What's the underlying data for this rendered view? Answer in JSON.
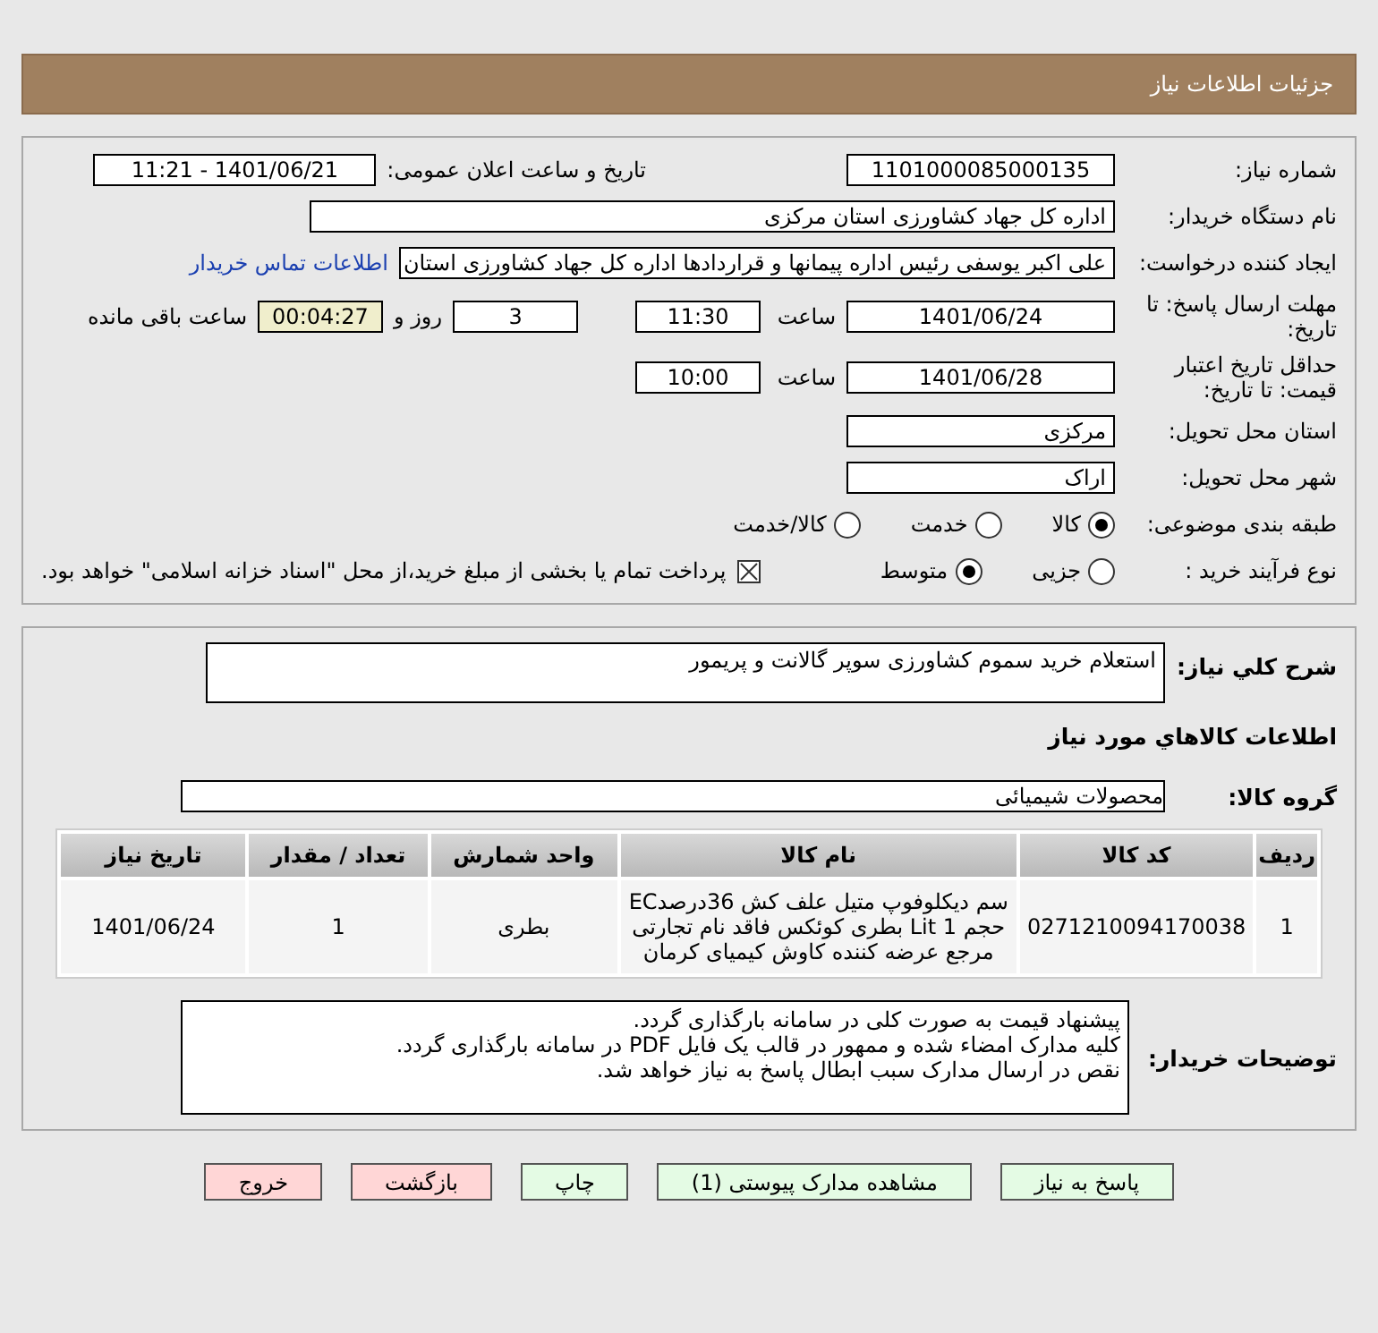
{
  "header": {
    "title": "جزئیات اطلاعات نیاز"
  },
  "details": {
    "need_number": {
      "label": "شماره نیاز:",
      "value": "1101000085000135"
    },
    "announce": {
      "label": "تاریخ و ساعت اعلان عمومی:",
      "value": "1401/06/21 - 11:21"
    },
    "buyer": {
      "label": "نام دستگاه خریدار:",
      "value": "اداره کل جهاد کشاورزی استان مرکزی"
    },
    "creator": {
      "label": "ایجاد کننده درخواست:",
      "value": "علی اکبر یوسفی رئیس اداره پیمانها و قراردادها اداره کل جهاد کشاورزی استان",
      "link": "اطلاعات تماس خریدار"
    },
    "deadline": {
      "label": "مهلت ارسال پاسخ: تا تاریخ:",
      "date": "1401/06/24",
      "time_label": "ساعت",
      "time": "11:30",
      "days": "3",
      "days_label": "روز و",
      "remaining": "00:04:27",
      "remaining_label": "ساعت باقی مانده"
    },
    "validity": {
      "label": "حداقل تاریخ اعتبار قیمت: تا تاریخ:",
      "date": "1401/06/28",
      "time_label": "ساعت",
      "time": "10:00"
    },
    "province": {
      "label": "استان محل تحویل:",
      "value": "مرکزی"
    },
    "city": {
      "label": "شهر محل تحویل:",
      "value": "اراک"
    },
    "category": {
      "label": "طبقه بندی موضوعی:",
      "options": [
        {
          "label": "کالا",
          "selected": true
        },
        {
          "label": "خدمت",
          "selected": false
        },
        {
          "label": "کالا/خدمت",
          "selected": false
        }
      ]
    },
    "process": {
      "label": "نوع فرآیند خرید :",
      "options": [
        {
          "label": "جزیی",
          "selected": false
        },
        {
          "label": "متوسط",
          "selected": true
        }
      ],
      "payment": {
        "checked": true,
        "text": "پرداخت تمام یا بخشی از مبلغ خرید،از محل \"اسناد خزانه اسلامی\" خواهد بود."
      }
    }
  },
  "summary": {
    "label": "شرح کلي نياز:",
    "value": "استعلام  خرید سموم کشاورزی سوپر گالانت و پریمور"
  },
  "goods_title": "اطلاعات کالاهاي مورد نياز",
  "group": {
    "label": "گروه کالا:",
    "value": "محصولات شیمیائی"
  },
  "table": {
    "columns": [
      "ردیف",
      "کد کالا",
      "نام کالا",
      "واحد شمارش",
      "تعداد / مقدار",
      "تاریخ نیاز"
    ],
    "rows": [
      [
        "1",
        "0271210094170038",
        "سم دیکلوفوپ متیل علف کش 36درصدEC حجم 1 Lit بطری کوئکس فاقد نام تجارتی مرجع عرضه کننده کاوش کیمیای کرمان",
        "بطری",
        "1",
        "1401/06/24"
      ]
    ]
  },
  "notes": {
    "label": "توضیحات خریدار:",
    "value": "پیشنهاد قیمت به صورت کلی در سامانه بارگذاری گردد.\nکلیه مدارک امضاء شده و ممهور در قالب یک فایل PDF  در سامانه بارگذاری گردد.\nنقص در ارسال مدارک سبب ابطال پاسخ به نیاز خواهد شد."
  },
  "buttons": [
    {
      "label": "پاسخ به نیاز",
      "kind": "normal"
    },
    {
      "label": "مشاهده مدارک پیوستی (1)",
      "kind": "normal"
    },
    {
      "label": "چاپ",
      "kind": "normal"
    },
    {
      "label": "بازگشت",
      "kind": "exit"
    },
    {
      "label": "خروج",
      "kind": "exit"
    }
  ]
}
